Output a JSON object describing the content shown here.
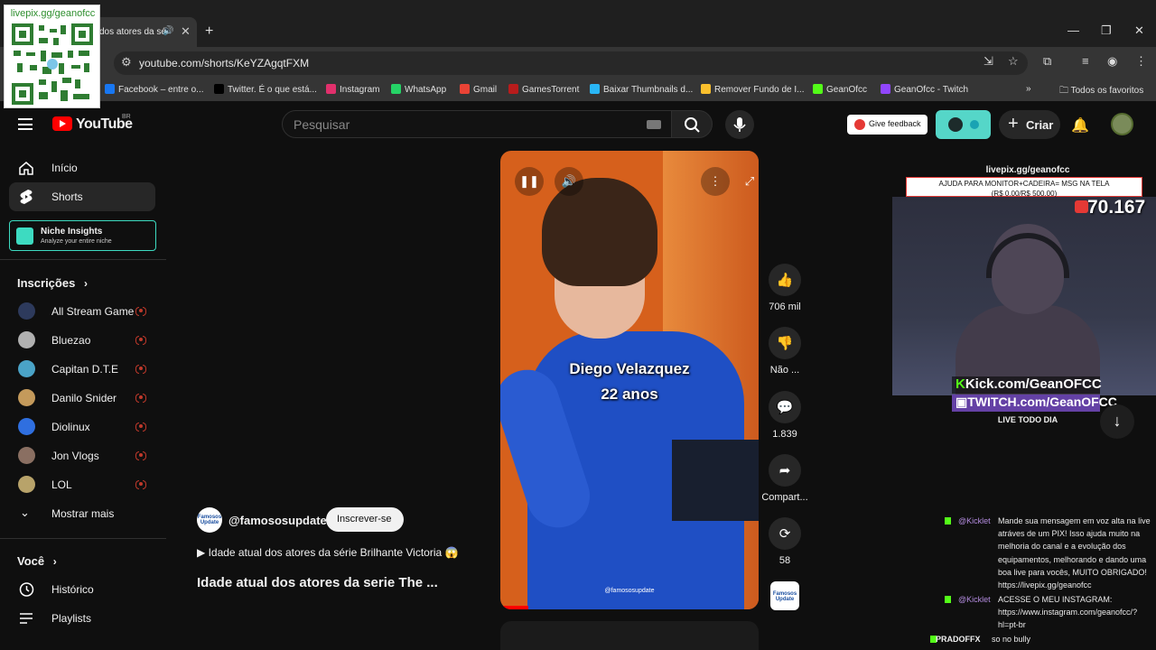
{
  "browser": {
    "tab_title": "dos atores da sé",
    "url": "youtube.com/shorts/KeYZAgqtFXM",
    "bookmarks": [
      {
        "label": "Facebook – entre o...",
        "color": "#1877f2"
      },
      {
        "label": "Twitter. É o que está...",
        "color": "#000000"
      },
      {
        "label": "Instagram",
        "color": "#e1306c"
      },
      {
        "label": "WhatsApp",
        "color": "#25d366"
      },
      {
        "label": "Gmail",
        "color": "#ea4335"
      },
      {
        "label": "GamesTorrent",
        "color": "#b71c1c"
      },
      {
        "label": "Baixar Thumbnails d...",
        "color": "#29b6f6"
      },
      {
        "label": "Remover Fundo de I...",
        "color": "#fbc02d"
      },
      {
        "label": "GeanOfcc",
        "color": "#53fc18"
      },
      {
        "label": "GeanOfcc - Twitch",
        "color": "#9146ff"
      }
    ],
    "all_favorites": "Todos os favoritos"
  },
  "qr_overlay": {
    "caption": "livepix.gg/geanofcc"
  },
  "header": {
    "logo_text": "YouTube",
    "country": "BR",
    "search_placeholder": "Pesquisar",
    "feedback_label": "Give feedback",
    "create_label": "Criar"
  },
  "sidebar": {
    "nav": [
      {
        "label": "Início",
        "icon": "home-icon"
      },
      {
        "label": "Shorts",
        "icon": "shorts-icon"
      }
    ],
    "niche": {
      "title": "Niche Insights",
      "subtitle": "Analyze your entire niche"
    },
    "subscriptions_title": "Inscrições",
    "subscriptions": [
      {
        "label": "All Stream Game",
        "color": "#2d3a5c"
      },
      {
        "label": "Bluezao",
        "color": "#b0b0b0"
      },
      {
        "label": "Capitan D.T.E",
        "color": "#4aa3c7"
      },
      {
        "label": "Danilo Snider",
        "color": "#c49a5b"
      },
      {
        "label": "Diolinux",
        "color": "#2f6fe0"
      },
      {
        "label": "Jon Vlogs",
        "color": "#8a6f62"
      },
      {
        "label": "LOL",
        "color": "#b8a36a"
      }
    ],
    "show_more": "Mostrar mais",
    "you_title": "Você",
    "you_items": [
      {
        "label": "Histórico",
        "icon": "history-icon"
      },
      {
        "label": "Playlists",
        "icon": "playlists-icon"
      }
    ]
  },
  "short": {
    "caption_line1": "Diego Velazquez",
    "caption_line2": "22 anos",
    "watermark": "@famososupdate",
    "progress": 0.11,
    "channel_handle": "@famososupdate",
    "channel_avatar_text": "Famosos Update",
    "subscribe_label": "Inscrever-se",
    "linked_video": "Idade atual dos atores da série Brilhante Victoria 😱",
    "title": "Idade atual dos atores da serie The ..."
  },
  "actions": {
    "likes": "706 mil",
    "dislike": "Não ...",
    "comments": "1.839",
    "share": "Compart...",
    "remix": "58"
  },
  "stream_overlay": {
    "link": "livepix.gg/geanofcc",
    "goal_line1": "AJUDA PARA MONITOR+CADEIRA= MSG NA TELA",
    "goal_line2": "(R$ 0.00/R$ 500.00)",
    "counter": "70.167",
    "kick": "Kick.com/GeanOFCC",
    "twitch": "TWITCH.com/GeanOFCC",
    "live_note": "LIVE TODO DIA",
    "chat": [
      {
        "user": "@Kicklet",
        "text": "Mande sua mensagem em voz alta na live atráves de um PIX! Isso ajuda muito na melhoria do canal e a evolução dos equipamentos, melhorando e dando uma boa live para vocês, MUITO OBRIGADO! https://livepix.gg/geanofcc"
      },
      {
        "user": "@Kicklet",
        "text": "ACESSE O MEU INSTAGRAM: https://www.instagram.com/geanofcc/?hl=pt-br"
      },
      {
        "user": "PRADOFFX",
        "text": "so no bully"
      }
    ]
  }
}
